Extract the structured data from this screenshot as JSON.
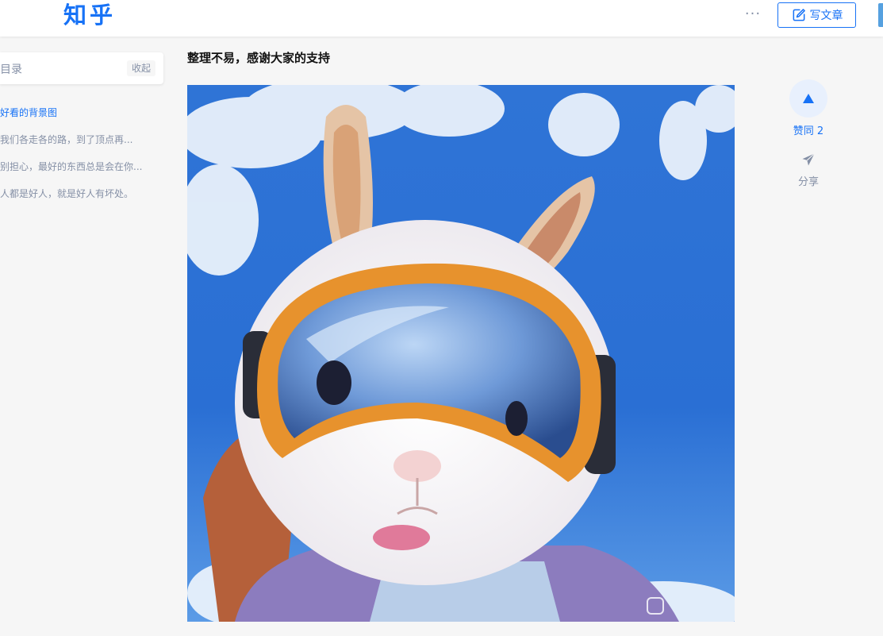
{
  "header": {
    "logo": "知乎",
    "more_label": "···",
    "write_label": "写文章"
  },
  "toc": {
    "title": "目录",
    "collapse_label": "收起",
    "items": [
      {
        "label": "好看的背景图",
        "active": true
      },
      {
        "label": "我们各走各的路，到了顶点再..."
      },
      {
        "label": "别担心，最好的东西总是会在你..."
      },
      {
        "label": "人都是好人，就是好人有坏处。"
      }
    ]
  },
  "article": {
    "title": "整理不易，感谢大家的支持"
  },
  "actions": {
    "vote_label": "赞同 2",
    "share_label": "分享"
  },
  "colors": {
    "brand": "#1772f6",
    "muted": "#8590a6",
    "sky": "#1f6fd8"
  }
}
